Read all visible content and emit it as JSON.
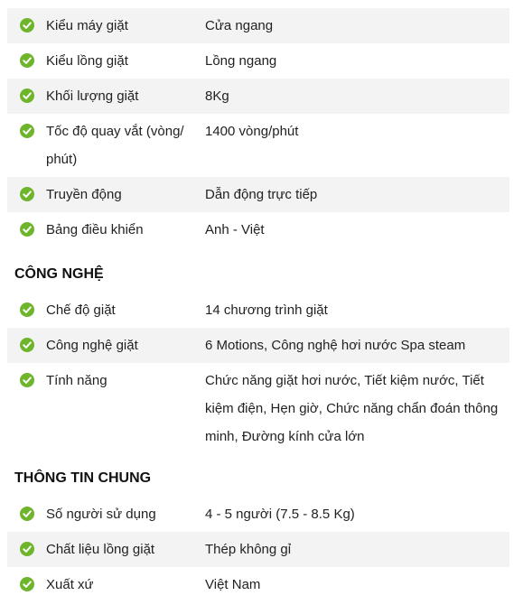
{
  "colors": {
    "check": "#6fb52c",
    "shaded_row": "#f3f3f3"
  },
  "icon": "check-circle-icon",
  "section_basic": {
    "rows": [
      {
        "label": "Kiểu máy giặt",
        "value": "Cửa ngang"
      },
      {
        "label": "Kiểu lồng giặt",
        "value": "Lồng ngang"
      },
      {
        "label": "Khối lượng giặt",
        "value": "8Kg"
      },
      {
        "label": "Tốc độ quay vắt (vòng/ phút)",
        "value": "1400 vòng/phút"
      },
      {
        "label": "Truyền động",
        "value": "Dẫn động trực tiếp"
      },
      {
        "label": "Bảng điều khiển",
        "value": "Anh - Việt"
      }
    ]
  },
  "section_tech": {
    "title": "CÔNG NGHỆ",
    "rows": [
      {
        "label": "Chế độ giặt",
        "value": "14 chương trình giặt"
      },
      {
        "label": "Công nghệ giặt",
        "value": "6 Motions, Công nghệ hơi nước Spa steam"
      },
      {
        "label": "Tính năng",
        "value": "Chức năng giặt hơi nước, Tiết kiệm nước, Tiết kiệm điện, Hẹn giờ, Chức năng chẩn đoán thông minh, Đường kính cửa lớn"
      }
    ]
  },
  "section_general": {
    "title": "THÔNG TIN CHUNG",
    "rows": [
      {
        "label": "Số người sử dụng",
        "value": "4 - 5 người (7.5 - 8.5 Kg)"
      },
      {
        "label": "Chất liệu lồng giặt",
        "value": "Thép không gỉ"
      },
      {
        "label": "Xuất xứ",
        "value": "Việt Nam"
      }
    ]
  }
}
